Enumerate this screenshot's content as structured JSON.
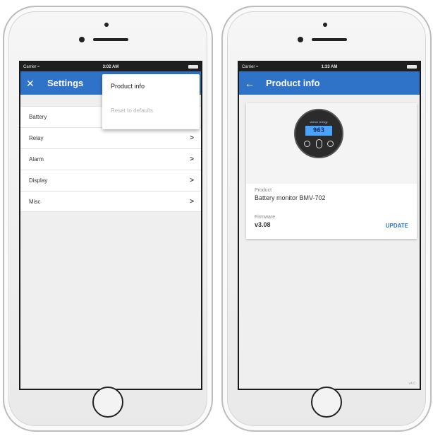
{
  "left_phone": {
    "status_bar": {
      "carrier": "Carrier ≈",
      "time": "3:02 AM"
    },
    "app_bar": {
      "close_icon": "close-icon",
      "title": "Settings"
    },
    "settings_list": [
      {
        "label": "Battery"
      },
      {
        "label": "Relay",
        "chevron": ">"
      },
      {
        "label": "Alarm",
        "chevron": ">"
      },
      {
        "label": "Display",
        "chevron": ">"
      },
      {
        "label": "Misc",
        "chevron": ">"
      }
    ],
    "dropdown_menu": {
      "product_info": "Product info",
      "reset_to_defaults": "Reset to defaults"
    }
  },
  "right_phone": {
    "status_bar": {
      "carrier": "Carrier ≈",
      "time": "1:33 AM"
    },
    "app_bar": {
      "back_icon": "back-arrow-icon",
      "title": "Product info"
    },
    "device_image": {
      "brand": "victron energy",
      "display": "963"
    },
    "product": {
      "label": "Product",
      "value": "Battery monitor BMV-702"
    },
    "firmware": {
      "label": "Firmware",
      "value": "v3.08",
      "update": "UPDATE"
    },
    "app_version": "v4.0"
  },
  "colors": {
    "app_bar": "#2f73c9",
    "status_bar": "#1f1f1f",
    "link": "#2f73c9"
  }
}
